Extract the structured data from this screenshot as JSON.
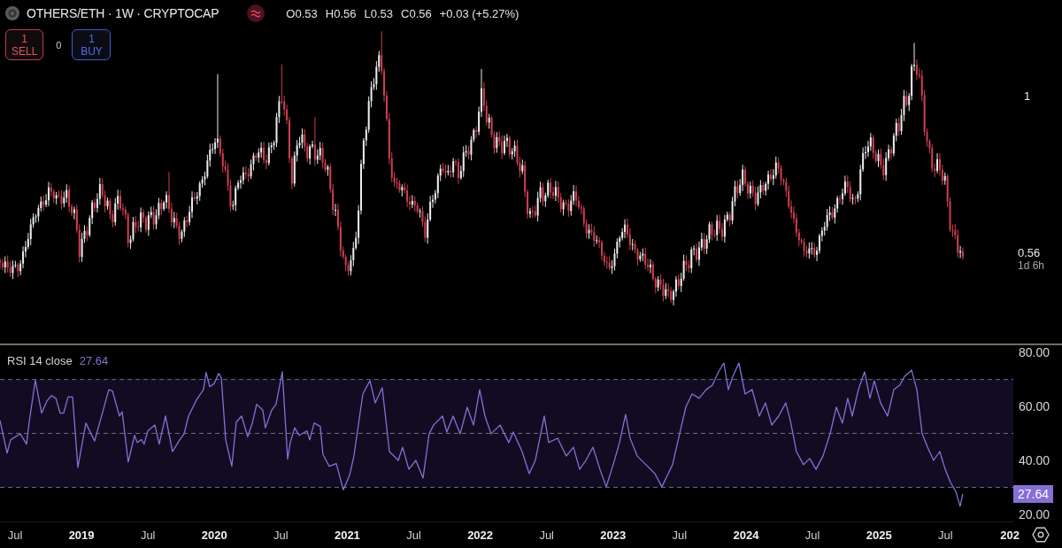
{
  "header": {
    "symbol": "OTHERS/ETH · 1W · CRYPTOCAP",
    "ohlc": [
      "O0.53",
      "H0.56",
      "L0.53",
      "C0.56",
      "+0.03 (+5.27%)"
    ]
  },
  "trade": {
    "buttons": [
      {
        "kind": "sell",
        "price": "1",
        "label": "SELL"
      },
      {
        "kind": "buy",
        "price": "1",
        "label": "BUY"
      }
    ],
    "spread": "0"
  },
  "price_axis": {
    "labels": [
      "1"
    ],
    "last_price": "0.56",
    "countdown": "1d 6h"
  },
  "rsi": {
    "legend_value": "27.64",
    "axis_value": "27.64",
    "cut_time_label": "202",
    "chart_data": {
      "type": "line",
      "x": [
        2018.387,
        2018.44,
        2018.467,
        2018.52,
        2018.54,
        2018.587,
        2018.607,
        2018.653,
        2018.7,
        2018.74,
        2018.773,
        2018.807,
        2018.84,
        2018.866,
        2018.9,
        2018.933,
        2018.973,
        2019.033,
        2019.099,
        2019.206,
        2019.233,
        2019.286,
        2019.306,
        2019.352,
        2019.399,
        2019.419,
        2019.452,
        2019.472,
        2019.499,
        2019.552,
        2019.585,
        2019.632,
        2019.685,
        2019.739,
        2019.772,
        2019.805,
        2019.865,
        2019.918,
        2019.938,
        2019.965,
        2019.998,
        2020.032,
        2020.052,
        2020.085,
        2020.131,
        2020.165,
        2020.205,
        2020.251,
        2020.285,
        2020.318,
        2020.364,
        2020.384,
        2020.431,
        2020.464,
        2020.511,
        2020.551,
        2020.571,
        2020.604,
        2020.637,
        2020.697,
        2020.717,
        2020.751,
        2020.797,
        2020.817,
        2020.864,
        2020.917,
        2020.97,
        2021.017,
        2021.05,
        2021.117,
        2021.17,
        2021.21,
        2021.263,
        2021.317,
        2021.383,
        2021.416,
        2021.463,
        2021.516,
        2021.57,
        2021.616,
        2021.649,
        2021.716,
        2021.749,
        2021.796,
        2021.849,
        2021.902,
        2021.949,
        2021.996,
        2022.036,
        2022.082,
        2022.149,
        2022.215,
        2022.249,
        2022.315,
        2022.369,
        2022.415,
        2022.482,
        2022.515,
        2022.582,
        2022.648,
        2022.701,
        2022.748,
        2022.795,
        2022.848,
        2022.901,
        2022.948,
        2023.001,
        2023.048,
        2023.094,
        2023.128,
        2023.181,
        2023.247,
        2023.314,
        2023.367,
        2023.414,
        2023.447,
        2023.5,
        2023.547,
        2023.594,
        2023.647,
        2023.7,
        2023.747,
        2023.793,
        2023.833,
        2023.867,
        2023.9,
        2023.946,
        2023.993,
        2024.046,
        2024.1,
        2024.146,
        2024.193,
        2024.246,
        2024.299,
        2024.333,
        2024.379,
        2024.432,
        2024.479,
        2024.526,
        2024.579,
        2024.632,
        2024.679,
        2024.725,
        2024.765,
        2024.799,
        2024.845,
        2024.892,
        2024.932,
        2024.965,
        2025.012,
        2025.065,
        2025.112,
        2025.158,
        2025.192,
        2025.245,
        2025.285,
        2025.325,
        2025.365,
        2025.411,
        2025.458,
        2025.498,
        2025.538,
        2025.578,
        2025.611,
        2025.631
      ],
      "series": [
        {
          "name": "RSI 14 close",
          "color": "#8670d6",
          "values": [
            54.8,
            42.7,
            47.6,
            49.3,
            49.8,
            46,
            54.2,
            69.7,
            57.5,
            62,
            64,
            63,
            57.5,
            57.5,
            63.5,
            63.5,
            37.4,
            53.8,
            47.2,
            66.2,
            65.7,
            56.4,
            58,
            39.4,
            49.3,
            46.6,
            47.7,
            46,
            50.9,
            53.1,
            46,
            56.4,
            43.3,
            47.6,
            49.8,
            56.4,
            62.4,
            66.2,
            72.6,
            67.3,
            68.4,
            72.2,
            70.6,
            47.6,
            37.8,
            54.2,
            56.4,
            48.8,
            53.7,
            60.8,
            58.6,
            52,
            58.6,
            60.8,
            72.8,
            40.5,
            46.6,
            52.1,
            49.3,
            50.9,
            47.6,
            53.8,
            52.6,
            42.2,
            37.8,
            38.8,
            29.1,
            34.5,
            41.6,
            64.6,
            69.5,
            61.3,
            66.9,
            43.3,
            40,
            44.9,
            36.7,
            40,
            33.4,
            49.8,
            53.1,
            56.4,
            50.5,
            56.4,
            49.8,
            59.7,
            53.1,
            66.2,
            56.4,
            49.8,
            53.1,
            46.6,
            50.5,
            43.3,
            35.1,
            40,
            56.4,
            46.6,
            48.2,
            41.6,
            44.9,
            36.7,
            40,
            44.9,
            36.7,
            30.2,
            38.4,
            46.6,
            57,
            48.2,
            41.6,
            38.4,
            35.1,
            30.2,
            35.1,
            38.4,
            49.8,
            59.7,
            64.6,
            63,
            66.2,
            67.9,
            72.8,
            76.1,
            66.2,
            71.1,
            76.1,
            64.6,
            66.2,
            56.4,
            61.3,
            53.1,
            56.4,
            61.3,
            54.8,
            43.3,
            38.4,
            40.7,
            36.7,
            41.6,
            49.8,
            59.7,
            53.8,
            63,
            56.4,
            66.2,
            72.8,
            63,
            69.5,
            61.3,
            56.4,
            66.2,
            67.9,
            71.1,
            73.4,
            66.2,
            49.8,
            44.9,
            40,
            43.3,
            36.7,
            31.8,
            28.5,
            23,
            27.6
          ]
        }
      ],
      "xlim": [
        2018.387,
        2026.011
      ],
      "ylim": [
        17.05,
        83.3
      ],
      "xticks": [
        {
          "value": 2018.5,
          "label": "Jul"
        },
        {
          "value": 2019,
          "label": "2019"
        },
        {
          "value": 2019.5,
          "label": "Jul"
        },
        {
          "value": 2020,
          "label": "2020"
        },
        {
          "value": 2020.5,
          "label": "Jul"
        },
        {
          "value": 2021,
          "label": "2021"
        },
        {
          "value": 2021.5,
          "label": "Jul"
        },
        {
          "value": 2022,
          "label": "2022"
        },
        {
          "value": 2022.5,
          "label": "Jul"
        },
        {
          "value": 2023,
          "label": "2023"
        },
        {
          "value": 2023.5,
          "label": "Jul"
        },
        {
          "value": 2024,
          "label": "2024"
        },
        {
          "value": 2024.5,
          "label": "Jul"
        },
        {
          "value": 2025,
          "label": "2025"
        },
        {
          "value": 2025.5,
          "label": "Jul"
        }
      ],
      "yticks": [
        {
          "value": 80,
          "label": "80.00"
        },
        {
          "value": 60,
          "label": "60.00"
        },
        {
          "value": 40,
          "label": "40.00"
        },
        {
          "value": 20,
          "label": "20.00"
        }
      ],
      "bands": [
        {
          "axis": "y",
          "from": 30,
          "to": 70
        }
      ],
      "ref_lines": [
        {
          "axis": "y",
          "value": 70
        },
        {
          "axis": "y",
          "value": 50
        },
        {
          "axis": "y",
          "value": 30
        }
      ]
    }
  }
}
